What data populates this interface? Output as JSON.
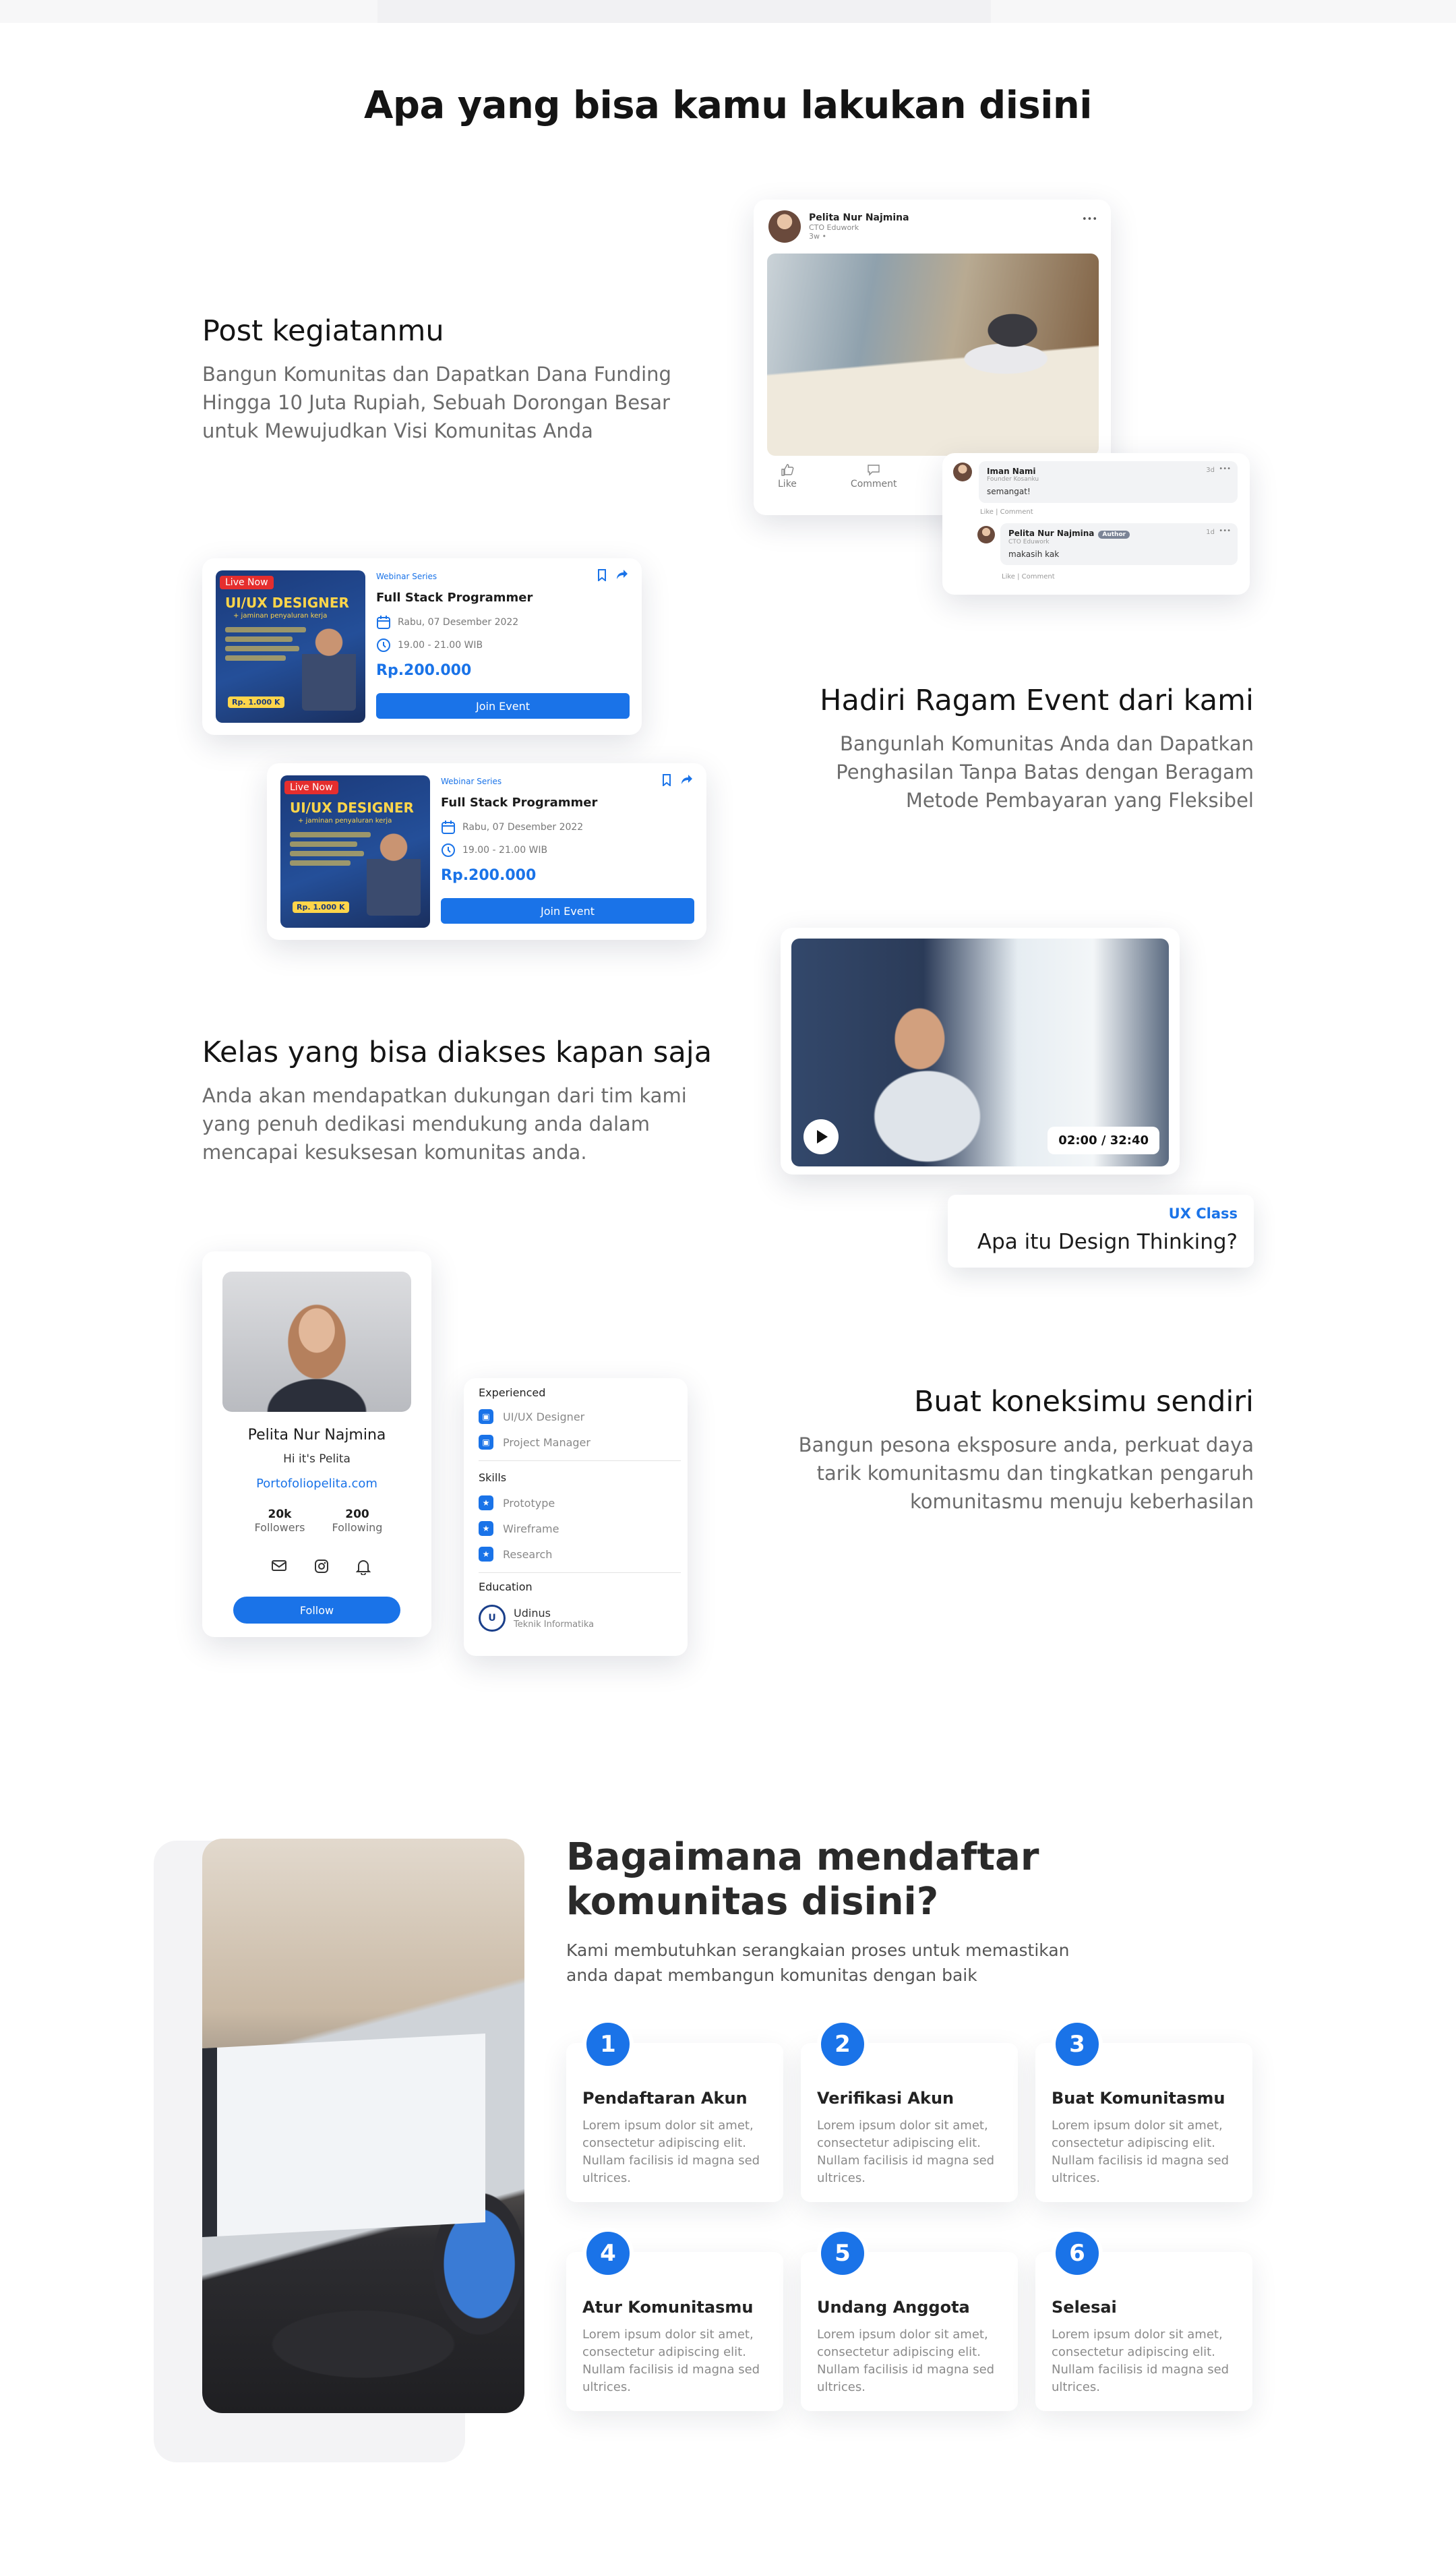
{
  "page": {
    "title": "Apa yang bisa kamu lakukan disini"
  },
  "features": [
    {
      "title": "Post kegiatanmu",
      "description": "Bangun Komunitas dan Dapatkan Dana Funding Hingga 10 Juta Rupiah, Sebuah Dorongan Besar untuk Mewujudkan Visi Komunitas Anda"
    },
    {
      "title": "Hadiri Ragam Event dari kami",
      "description": "Bangunlah Komunitas Anda dan Dapatkan Penghasilan Tanpa Batas dengan Beragam Metode Pembayaran yang Fleksibel"
    },
    {
      "title": "Kelas yang bisa diakses kapan saja",
      "description": "Anda akan mendapatkan dukungan dari tim kami yang penuh dedikasi mendukung anda dalam mencapai kesuksesan komunitas anda."
    },
    {
      "title": "Buat koneksimu sendiri",
      "description": "Bangun pesona eksposure anda, perkuat daya tarik komunitasmu dan tingkatkan pengaruh komunitasmu menuju keberhasilan"
    }
  ],
  "post": {
    "author": "Pelita Nur Najmina",
    "role": "CTO Eduwork",
    "time": "3w •",
    "more": "•••",
    "like_label": "Like",
    "comment_label": "Comment"
  },
  "comments": [
    {
      "name": "Iman Nami",
      "role": "Founder Kosanku",
      "text": "semangat!",
      "time": "3d",
      "more": "•••",
      "links": "Like  |  Comment"
    },
    {
      "name": "Pelita Nur Najmina",
      "badge": "Author",
      "role": "CTO Eduwork",
      "text": "makasih kak",
      "time": "1d",
      "more": "•••",
      "links": "Like  |  Comment"
    }
  ],
  "events": [
    {
      "live_label": "Live Now",
      "poster_title": "UI/UX DESIGNER",
      "poster_subtitle": "+ jaminan penyaluran kerja",
      "poster_price": "Rp. 1.000 K",
      "series": "Webinar Series",
      "title": "Full Stack Programmer",
      "date": "Rabu, 07 Desember 2022",
      "time": "19.00 - 21.00 WIB",
      "price": "Rp.200.000",
      "button": "Join Event"
    },
    {
      "live_label": "Live Now",
      "poster_title": "UI/UX DESIGNER",
      "poster_subtitle": "+ jaminan penyaluran kerja",
      "poster_price": "Rp. 1.000 K",
      "series": "Webinar Series",
      "title": "Full Stack Programmer",
      "date": "Rabu, 07 Desember 2022",
      "time": "19.00 - 21.00 WIB",
      "price": "Rp.200.000",
      "button": "Join Event"
    }
  ],
  "video": {
    "time": "02:00 / 32:40",
    "category": "UX Class",
    "title": "Apa itu Design Thinking?"
  },
  "profile": {
    "name": "Pelita Nur Najmina",
    "bio": "Hi it's Pelita",
    "link": "Portofoliopelita.com",
    "followers_count": "20k",
    "followers_label": "Followers",
    "following_count": "200",
    "following_label": "Following",
    "follow_button": "Follow",
    "experienced_label": "Experienced",
    "experiences": [
      "UI/UX Designer",
      "Project Manager"
    ],
    "skills_label": "Skills",
    "skills": [
      "Prototype",
      "Wireframe",
      "Research"
    ],
    "education_label": "Education",
    "school": "Udinus",
    "major": "Teknik Informatika"
  },
  "howto": {
    "title_line1": "Bagaimana mendaftar",
    "title_line2": "komunitas disini?",
    "description": "Kami membutuhkan serangkaian proses untuk memastikan anda dapat membangun komunitas dengan baik",
    "steps": [
      {
        "number": "1",
        "title": "Pendaftaran Akun",
        "text": "Lorem ipsum dolor sit amet, consectetur adipiscing elit. Nullam facilisis id magna sed ultrices."
      },
      {
        "number": "2",
        "title": "Verifikasi Akun",
        "text": "Lorem ipsum dolor sit amet, consectetur adipiscing elit. Nullam facilisis id magna sed ultrices."
      },
      {
        "number": "3",
        "title": "Buat Komunitasmu",
        "text": "Lorem ipsum dolor sit amet, consectetur adipiscing elit. Nullam facilisis id magna sed ultrices."
      },
      {
        "number": "4",
        "title": "Atur Komunitasmu",
        "text": "Lorem ipsum dolor sit amet, consectetur adipiscing elit. Nullam facilisis id magna sed ultrices."
      },
      {
        "number": "5",
        "title": "Undang Anggota",
        "text": "Lorem ipsum dolor sit amet, consectetur adipiscing elit. Nullam facilisis id magna sed ultrices."
      },
      {
        "number": "6",
        "title": "Selesai",
        "text": "Lorem ipsum dolor sit amet, consectetur adipiscing elit. Nullam facilisis id magna sed ultrices."
      }
    ]
  },
  "colors": {
    "accent": "#1a73e8",
    "heading": "#141414",
    "body_text": "#6b6b6b"
  }
}
